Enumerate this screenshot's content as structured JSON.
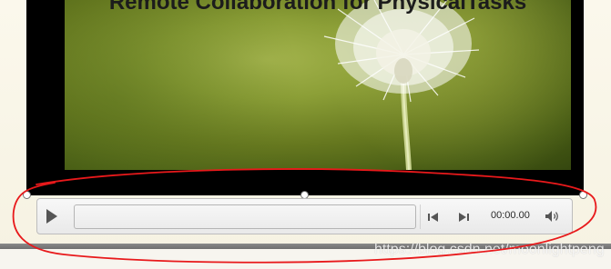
{
  "slide": {
    "video_title": "Remote Collaboration for PhysicalTasks"
  },
  "player": {
    "play_icon": "play-icon",
    "skip_back_icon": "skip-back-icon",
    "skip_forward_icon": "skip-forward-icon",
    "volume_icon": "volume-icon",
    "time": "00:00.00",
    "progress": 0
  },
  "watermark": {
    "text": "https://blog.csdn.net/moonlightpeng"
  },
  "colors": {
    "annotation": "#e8191b",
    "video_background": "#000000",
    "control_bar": "#eeeeee"
  }
}
